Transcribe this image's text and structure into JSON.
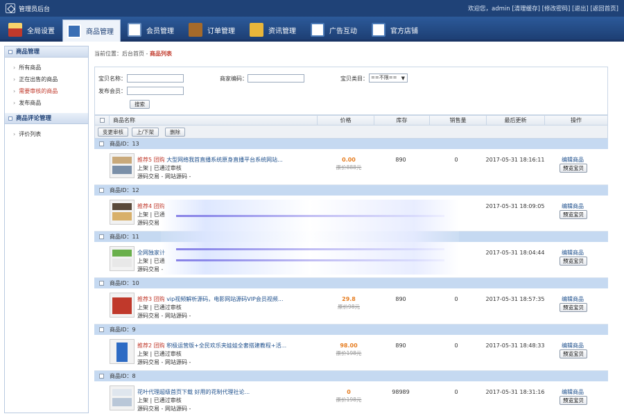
{
  "header": {
    "app_title": "管理员后台",
    "user_text": "欢迎您，",
    "username": "admin",
    "links": [
      "[清理缓存]",
      "[修改密码]",
      "[退出]",
      "[返回首页]"
    ]
  },
  "nav": {
    "items": [
      {
        "label": "全局设置",
        "icon": "house-icon"
      },
      {
        "label": "商品管理",
        "icon": "shop-icon",
        "active": true
      },
      {
        "label": "会员管理",
        "icon": "member-icon"
      },
      {
        "label": "订单管理",
        "icon": "order-icon"
      },
      {
        "label": "资讯管理",
        "icon": "news-icon"
      },
      {
        "label": "广告互动",
        "icon": "ad-icon"
      },
      {
        "label": "官方店铺",
        "icon": "store-icon"
      }
    ]
  },
  "sidebar": {
    "section1_title": "商品管理",
    "section1_items": [
      "所有商品",
      "正在出售的商品",
      "需要审核的商品",
      "发布商品"
    ],
    "section2_title": "商品评论管理",
    "section2_items": [
      "评价列表"
    ]
  },
  "breadcrumb": {
    "prefix": "当前位置：",
    "home": "后台首页",
    "sep": " - ",
    "current": "商品列表"
  },
  "search": {
    "name_label": "宝贝名称：",
    "code_label": "商家编码：",
    "category_label": "宝贝类目：",
    "category_value": "==不限==",
    "member_label": "发布会员：",
    "submit_label": "搜索"
  },
  "table": {
    "headers": {
      "name": "商品名称",
      "price": "价格",
      "stock": "库存",
      "sales": "销售量",
      "updated": "最后更新",
      "ops": "操作"
    },
    "toolbar": [
      "变更审核",
      "上/下架",
      "删除"
    ],
    "edit_label": "编辑商品",
    "preview_label": "预览宝贝",
    "rows": [
      {
        "group": "商品ID：13",
        "title_tag": "推荐5 团购",
        "title": "大型网络我首直播系统原身直播平台系统网站...",
        "status": "上架 | 已通过审核",
        "type": "源码交易 - 网站源码 -",
        "price": "0.00",
        "orig": "原价888元",
        "stock": "890",
        "sales": "0",
        "updated": "2017-05-31 18:16:11"
      },
      {
        "group": "商品ID：12",
        "title_tag": "推荐4 团购",
        "title": "",
        "status": "上架 | 已通",
        "type": "源码交易",
        "price": "",
        "orig": "",
        "stock": "",
        "sales": "",
        "updated": "2017-05-31 18:09:05"
      },
      {
        "group": "商品ID：11",
        "title_tag": "",
        "title": "全网独家计",
        "status": "上架 | 已通",
        "type": "源码交易 -",
        "price": "",
        "orig": "",
        "stock": "",
        "sales": "",
        "updated": "2017-05-31 18:04:44"
      },
      {
        "group": "商品ID：10",
        "title_tag": "推荐3 团购",
        "title": "vip视频解析源码，电影网站源码VIP会员视频...",
        "status": "上架 | 已通过审核",
        "type": "源码交易 - 网站源码 -",
        "price": "29.8",
        "orig": "原价98元",
        "stock": "890",
        "sales": "0",
        "updated": "2017-05-31 18:57:35"
      },
      {
        "group": "商品ID：9",
        "title_tag": "推荐2 团购",
        "title": "积极运营版+全民欢乐夹娃娃全套搭建教程+活...",
        "status": "上架 | 已通过审核",
        "type": "源码交易 - 网站源码 -",
        "price": "98.00",
        "orig": "原价198元",
        "stock": "890",
        "sales": "0",
        "updated": "2017-05-31 18:48:33"
      },
      {
        "group": "商品ID：8",
        "title_tag": "",
        "title": "花叶代理超级首页下载 好用的花制代理社论...",
        "status": "上架 | 已通过审核",
        "type": "源码交易 - 网站源码 -",
        "price": "0",
        "orig": "原价198元",
        "stock": "98989",
        "sales": "0",
        "updated": "2017-05-31 18:31:16"
      }
    ]
  }
}
